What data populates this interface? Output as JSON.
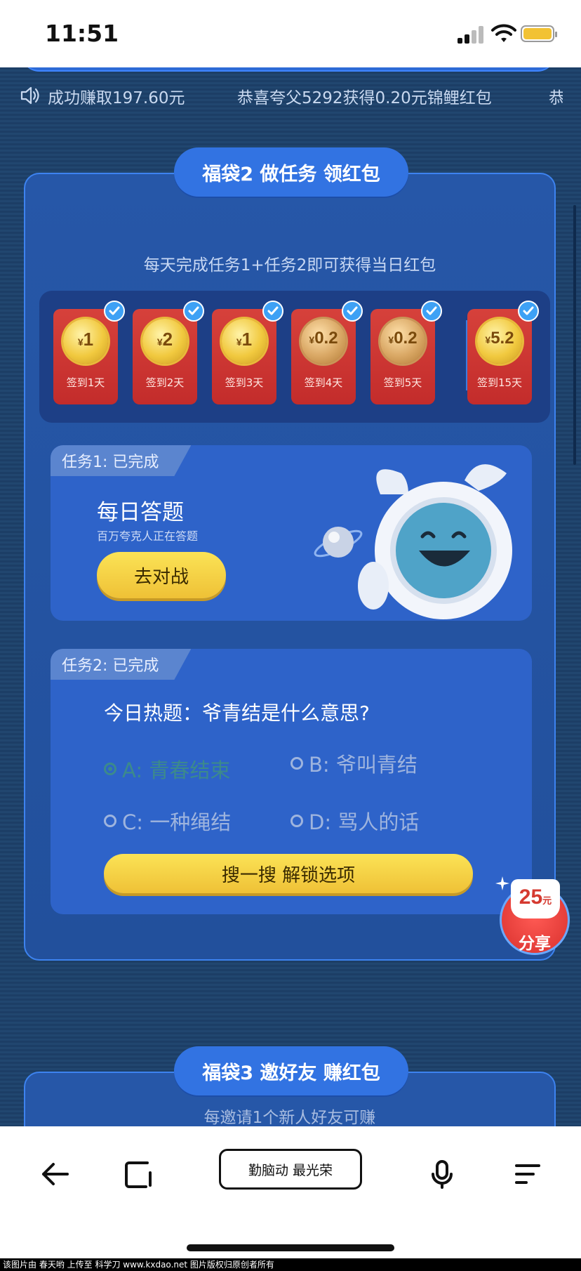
{
  "status_bar": {
    "time": "11:51"
  },
  "ticker": {
    "items": [
      "成功赚取197.60元",
      "恭喜夸父5292获得0.20元锦鲤红包",
      "恭"
    ]
  },
  "bag2": {
    "title": "福袋2 做任务 领红包",
    "subtitle": "每天完成任务1+任务2即可获得当日红包",
    "envelopes": [
      {
        "amount": "1",
        "label": "签到1天",
        "checked": true
      },
      {
        "amount": "2",
        "label": "签到2天",
        "checked": true
      },
      {
        "amount": "1",
        "label": "签到3天",
        "checked": true
      },
      {
        "amount": "0.2",
        "label": "签到4天",
        "checked": true
      },
      {
        "amount": "0.2",
        "label": "签到5天",
        "checked": true
      },
      {
        "amount": "5.2",
        "label": "签到15天",
        "checked": true
      }
    ],
    "currency_symbol": "¥",
    "task1": {
      "tag": "任务1: 已完成",
      "title": "每日答题",
      "desc": "百万夸克人正在答题",
      "button": "去对战"
    },
    "task2": {
      "tag": "任务2: 已完成",
      "question": "今日热题：爷青结是什么意思?",
      "options": [
        "A: 青春结束",
        "B: 爷叫青结",
        "C: 一种绳结",
        "D: 骂人的话"
      ],
      "selected": 0,
      "button": "搜一搜 解锁选项"
    }
  },
  "share": {
    "amount": "25",
    "unit": "元",
    "label": "分享"
  },
  "bag3": {
    "title": "福袋3 邀好友 赚红包",
    "partial_text": "每邀请1个新人好友可赚"
  },
  "toolbar": {
    "center_label": "勤脑动 最光荣"
  },
  "footnote": "该图片由 春天哟 上传至 科学刀 www.kxdao.net 图片版权归原创者所有",
  "colors": {
    "accent": "#3273e2",
    "yellow": "#f3cb3c",
    "envelope_red": "#cf3633"
  }
}
